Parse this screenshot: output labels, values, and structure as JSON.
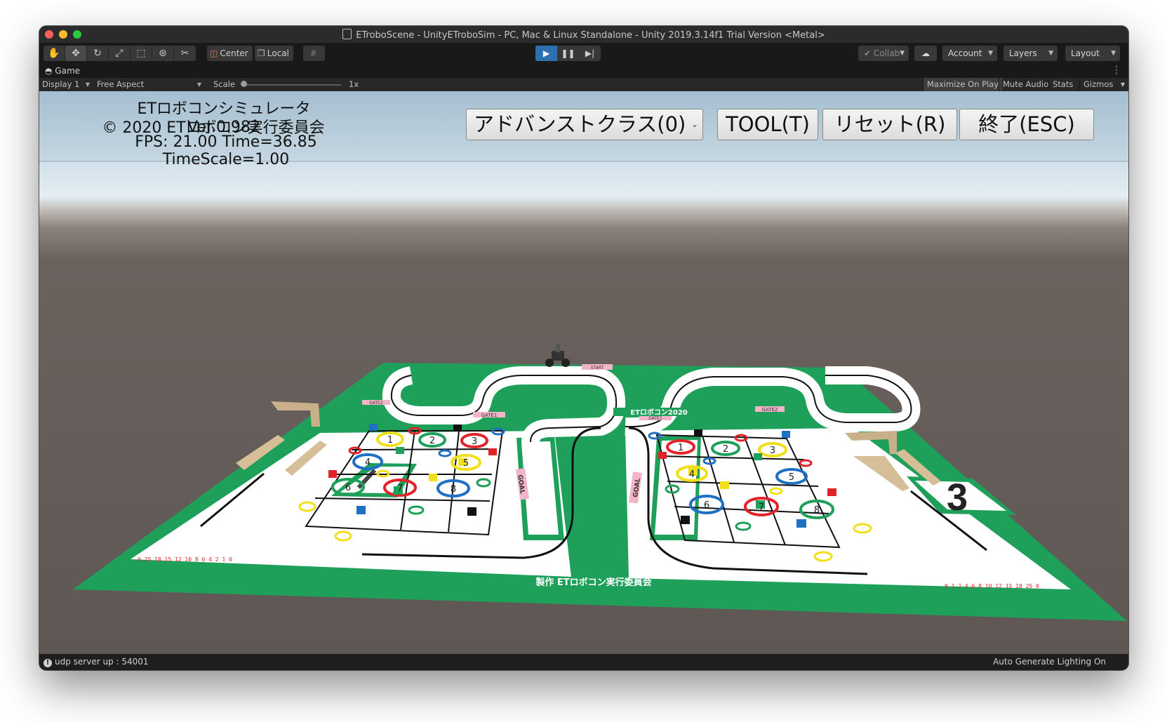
{
  "window": {
    "title": "ETroboScene - UnityETroboSim - PC, Mac & Linux Standalone - Unity 2019.3.14f1 Trial Version <Metal>"
  },
  "toolbar": {
    "pivot_label": "Center",
    "space_label": "Local",
    "collab_label": "Collab",
    "account_label": "Account",
    "layers_label": "Layers",
    "layout_label": "Layout"
  },
  "game_tab": {
    "label": "Game"
  },
  "game_bar": {
    "display": "Display 1",
    "aspect": "Free Aspect",
    "scale_label": "Scale",
    "scale_value": "1x",
    "maximize": "Maximize On Play",
    "mute": "Mute Audio",
    "stats": "Stats",
    "gizmos": "Gizmos"
  },
  "overlay": {
    "line1": "ETロボコンシミュレータ Ver.0.982",
    "line2": "© 2020 ETロボコン実行委員会",
    "line3": "FPS: 21.00 Time=36.85 TimeScale=1.00"
  },
  "buttons": {
    "class_select": "アドバンストクラス(0)",
    "tool": "TOOL(T)",
    "reset": "リセット(R)",
    "exit": "終了(ESC)"
  },
  "field": {
    "credit": "製作 ETロボコン実行委員会",
    "start": "START",
    "goal": "GOAL",
    "gate1": "GATE1",
    "gate2": "GATE2",
    "logo": "ETロボコン2020",
    "card_number": "3",
    "ruler_left": "0 25 18 15 12 10 8 6 4 2 1 0",
    "ruler_right": "0 1 2 4 6 8 10 12 15 18 25 0",
    "grid_left": [
      "1",
      "2",
      "3",
      "4",
      "5",
      "6",
      "7",
      "8"
    ],
    "grid_right": [
      "1",
      "2",
      "3",
      "4",
      "5",
      "6",
      "7",
      "8"
    ],
    "colors": {
      "green": "#1fa05a",
      "white": "#ffffff",
      "red": "#e2232a",
      "blue": "#1f6fc4",
      "yellow": "#f2df1c"
    }
  },
  "status": {
    "left": "udp server up : 54001",
    "right": "Auto Generate Lighting On"
  }
}
